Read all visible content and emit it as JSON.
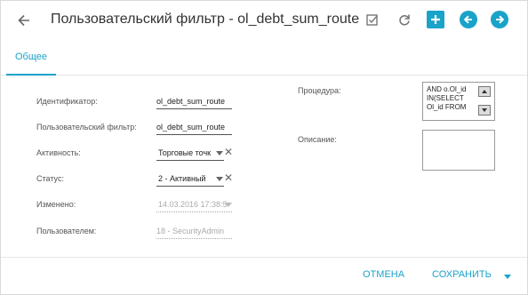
{
  "header": {
    "title": "Пользовательский фильтр - ol_debt_sum_route",
    "icons": [
      "back-arrow-icon",
      "checkbox-icon",
      "refresh-icon",
      "add-icon",
      "previous-icon",
      "next-icon"
    ]
  },
  "tabs": [
    {
      "label": "Общее",
      "active": true
    }
  ],
  "form": {
    "identifier": {
      "label": "Идентификатор:",
      "value": "ol_debt_sum_route"
    },
    "user_filter": {
      "label": "Пользовательский фильтр:",
      "value": "ol_debt_sum_route"
    },
    "activity": {
      "label": "Активность:",
      "value": "Торговые точк"
    },
    "status": {
      "label": "Статус:",
      "value": "2 - Активный"
    },
    "changed": {
      "label": "Изменено:",
      "value": "14.03.2016 17:38:5"
    },
    "user": {
      "label": "Пользователем:",
      "value": "18 - SecurityAdmin"
    },
    "procedure": {
      "label": "Процедура:",
      "value": "AND o.Ol_id\nIN(SELECT\nOl_id FROM"
    },
    "description": {
      "label": "Описание:",
      "value": ""
    }
  },
  "footer": {
    "cancel_label": "ОТМЕНА",
    "save_label": "СОХРАНИТЬ"
  },
  "colors": {
    "accent": "#1aa3c8"
  }
}
